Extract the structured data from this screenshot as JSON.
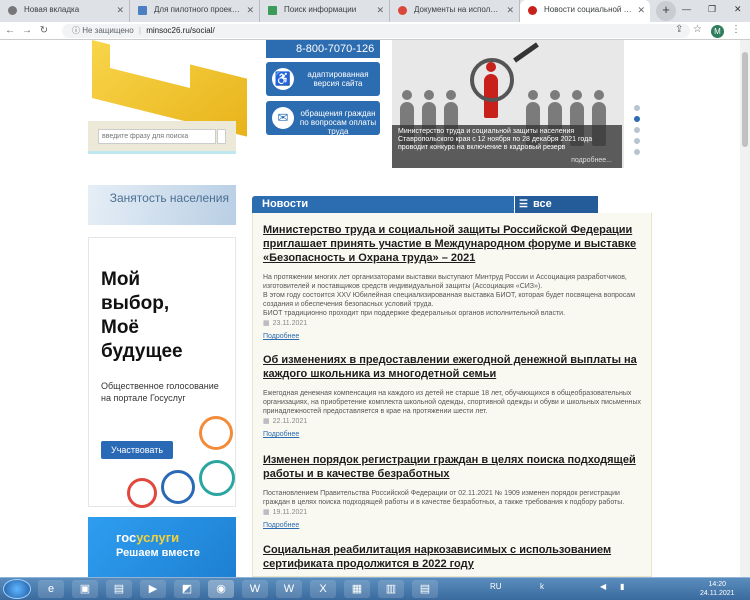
{
  "browser": {
    "tabs": [
      {
        "label": "Новая вкладка",
        "active": false
      },
      {
        "label": "Для пилотного проекта по",
        "active": false
      },
      {
        "label": "Поиск информации",
        "active": false
      },
      {
        "label": "Документы на исполнени",
        "active": false
      },
      {
        "label": "Новости социальной подд",
        "active": true
      }
    ],
    "new_tab": "+",
    "security": "Не защищено",
    "url": "minsoc26.ru/social/",
    "avatar_letter": "M",
    "window_controls": {
      "minimize": "—",
      "maximize": "❐",
      "close": "✕"
    }
  },
  "header": {
    "hotline": "8-800-7070-126",
    "accessible_version": "адаптированная версия сайта",
    "appeals": "обращения граждан по вопросам оплаты труда",
    "search_placeholder": "введите фразу для поиска"
  },
  "slider": {
    "caption": "Министерство труда и социальной защиты населения Ставропольского края с 12 ноября по 28 декабря 2021 года проводит конкурс на включение в кадровый резерв",
    "more": "подробнее..."
  },
  "sidebar": {
    "employment_banner": "Занятость населения",
    "vote_ad": {
      "heading_lines": [
        "Мой",
        "выбор,",
        "Моё",
        "будущее"
      ],
      "subtitle": "Общественное голосование на портале Госуслуг",
      "button": "Участвовать"
    },
    "gosuslugi": {
      "gos": "гос",
      "uslugi": "услуги",
      "tagline": "Решаем вместе"
    }
  },
  "news": {
    "header": "Новости",
    "all_news": "все новости",
    "items": [
      {
        "title": "Министерство труда и социальной защиты Российской Федерации приглашает принять участие в Международном форуме и выставке «Безопасность и Охрана труда» – 2021",
        "text": "На протяжении многих лет организаторами выставки выступают Минтруд России и Ассоциация разработчиков, изготовителей и поставщиков средств индивидуальной защиты (Ассоциация «СИЗ»).\nВ этом году состоится XXV Юбилейная специализированная выставка БИОТ, которая будет посвящена вопросам создания и обеспечения безопасных условий труда.\nБИОТ традиционно проходит при поддержке федеральных органов исполнительной власти.",
        "date": "23.11.2021",
        "more": "Подробнее"
      },
      {
        "title": "Об изменениях в предоставлении ежегодной денежной выплаты на каждого школьника из многодетной семьи",
        "text": "Ежегодная денежная компенсация на каждого из детей не старше 18 лет, обучающихся в общеобразовательных организациях, на приобретение комплекта школьной одежды, спортивной одежды и обуви и школьных письменных принадлежностей предоставляется в крае на протяжении шести лет.",
        "date": "22.11.2021",
        "more": "Подробнее"
      },
      {
        "title": "Изменен порядок регистрации граждан в целях поиска подходящей работы и в качестве безработных",
        "text": "Постановлением Правительства Российской Федерации от 02.11.2021 № 1909 изменен порядок регистрации граждан в целях поиска подходящей работы и в качестве безработных, а также требования к подбору работы.",
        "date": "19.11.2021",
        "more": "Подробнее"
      },
      {
        "title": "Социальная реабилитация наркозависимых с использованием сертификата продолжится в 2022 году",
        "text": "",
        "date": "",
        "more": ""
      }
    ]
  },
  "taskbar": {
    "lang": "RU",
    "time": "14:20",
    "date": "24.11.2021"
  },
  "colors": {
    "brand_blue": "#2c6cb0",
    "yellow": "#f8d54a",
    "accent_red": "#c8201b"
  }
}
